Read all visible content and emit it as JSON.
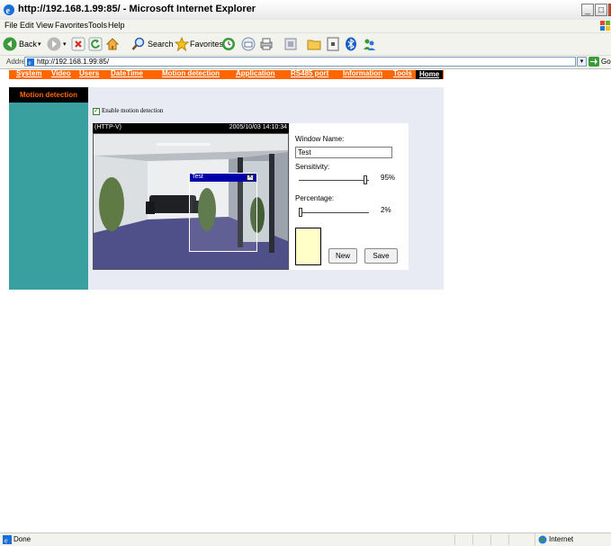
{
  "window": {
    "title": "http://192.168.1.99:85/ - Microsoft Internet Explorer"
  },
  "menu": [
    "File",
    "Edit",
    "View",
    "Favorites",
    "Tools",
    "Help"
  ],
  "toolbar": {
    "back": "Back",
    "search": "Search",
    "favorites": "Favorites"
  },
  "address": {
    "label": "Address",
    "url": "http://192.168.1.99:85/",
    "go": "Go"
  },
  "nav": {
    "items": [
      "System",
      "Video",
      "Users",
      "DateTime",
      "Motion detection",
      "Application",
      "RS485 port",
      "Information",
      "Tools"
    ],
    "home": "Home"
  },
  "sidebar": {
    "header": "Motion detection"
  },
  "enable": {
    "label": "Enable motion detection",
    "checked": true
  },
  "video": {
    "source": "(HTTP-V)",
    "timestamp": "2005/10/03 14:10:34",
    "window_title": "Test"
  },
  "panel": {
    "window_name_label": "Window Name:",
    "window_name_value": "Test",
    "sensitivity_label": "Sensitivity:",
    "sensitivity_value": "95%",
    "sensitivity_level": 0.95,
    "percentage_label": "Percentage:",
    "percentage_value": "2%",
    "percentage_level": 0.02,
    "new_button": "New",
    "save_button": "Save",
    "swatch_color": "#ffffc8"
  },
  "status": {
    "text": "Done",
    "zone": "Internet"
  },
  "colors": {
    "nav": "#ff6600",
    "sidebar": "#3a9f9f",
    "content_bg": "#e8eaf4"
  }
}
